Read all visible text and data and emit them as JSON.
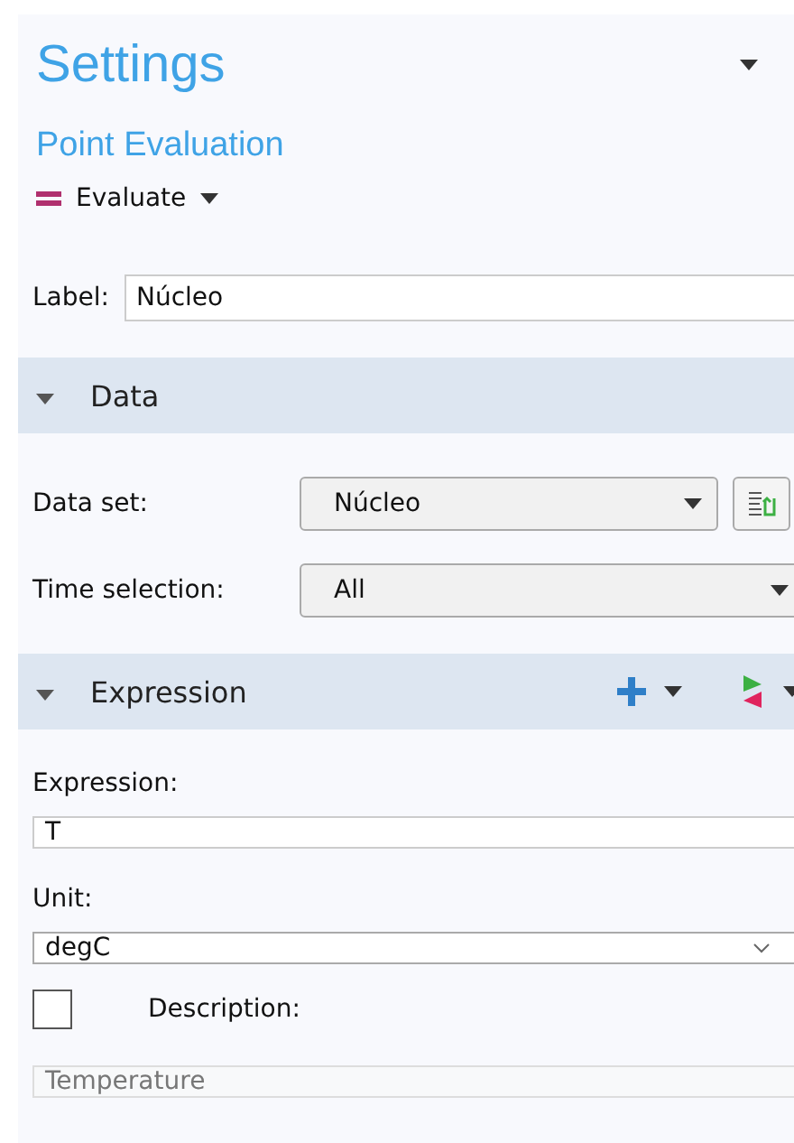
{
  "panel": {
    "title": "Settings",
    "subtitle": "Point Evaluation",
    "evaluate_button": "Evaluate"
  },
  "label": {
    "caption": "Label:",
    "value": "Núcleo"
  },
  "sections": [
    {
      "kind": "data",
      "title": "Data",
      "expanded": true,
      "rows": [
        {
          "caption": "Data set:",
          "value": "Núcleo",
          "has_button": true
        },
        {
          "caption": "Time selection:",
          "value": "All",
          "has_button": false
        }
      ]
    },
    {
      "kind": "expression",
      "title": "Expression",
      "expanded": true,
      "expression": {
        "caption": "Expression:",
        "value": "T"
      },
      "unit": {
        "caption": "Unit:",
        "value": "degC"
      },
      "description": {
        "caption": "Description:",
        "checked": false,
        "value": "Temperature",
        "disabled": true
      }
    }
  ]
}
